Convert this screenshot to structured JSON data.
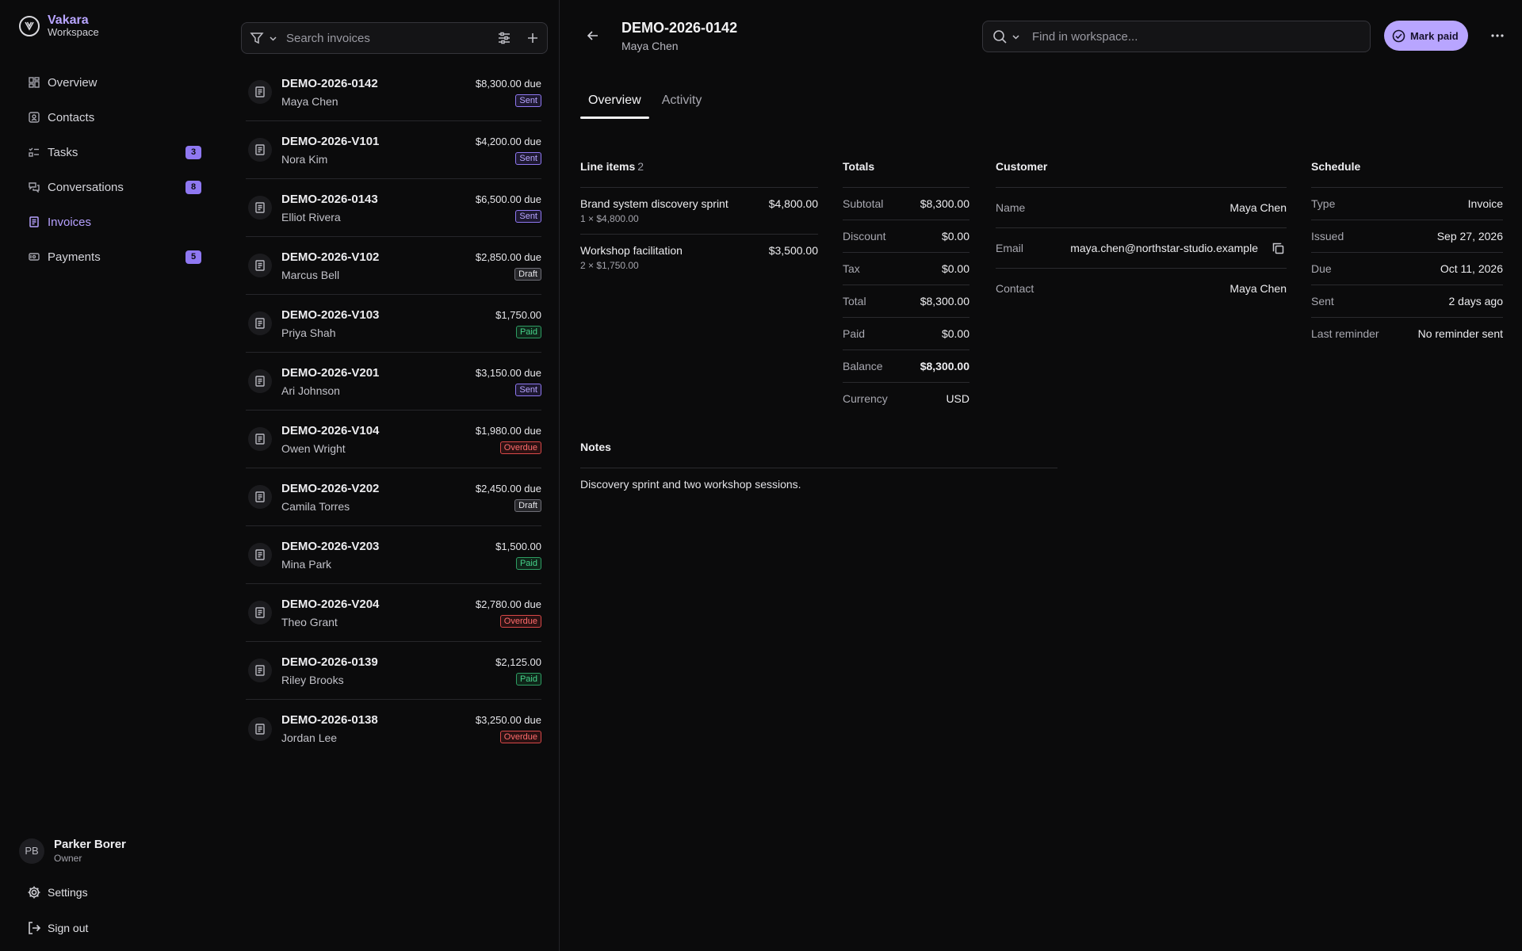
{
  "brand": {
    "name": "Vakara",
    "subtitle": "Workspace"
  },
  "nav": [
    {
      "label": "Overview",
      "icon": "dashboard-icon",
      "badge": null,
      "active": false
    },
    {
      "label": "Contacts",
      "icon": "contacts-icon",
      "badge": null,
      "active": false
    },
    {
      "label": "Tasks",
      "icon": "tasks-icon",
      "badge": "3",
      "active": false
    },
    {
      "label": "Conversations",
      "icon": "chat-icon",
      "badge": "8",
      "active": false
    },
    {
      "label": "Invoices",
      "icon": "invoice-icon",
      "badge": null,
      "active": true
    },
    {
      "label": "Payments",
      "icon": "payment-icon",
      "badge": "5",
      "active": false
    }
  ],
  "user": {
    "initials": "PB",
    "name": "Parker Borer",
    "role": "Owner"
  },
  "settings_label": "Settings",
  "signout_label": "Sign out",
  "list": {
    "search_placeholder": "Search invoices",
    "invoices": [
      {
        "number": "DEMO-2026-0142",
        "customer": "Maya Chen",
        "amount": "$8,300.00 due",
        "status": "Sent"
      },
      {
        "number": "DEMO-2026-V101",
        "customer": "Nora Kim",
        "amount": "$4,200.00 due",
        "status": "Sent"
      },
      {
        "number": "DEMO-2026-0143",
        "customer": "Elliot Rivera",
        "amount": "$6,500.00 due",
        "status": "Sent"
      },
      {
        "number": "DEMO-2026-V102",
        "customer": "Marcus Bell",
        "amount": "$2,850.00 due",
        "status": "Draft"
      },
      {
        "number": "DEMO-2026-V103",
        "customer": "Priya Shah",
        "amount": "$1,750.00",
        "status": "Paid"
      },
      {
        "number": "DEMO-2026-V201",
        "customer": "Ari Johnson",
        "amount": "$3,150.00 due",
        "status": "Sent"
      },
      {
        "number": "DEMO-2026-V104",
        "customer": "Owen Wright",
        "amount": "$1,980.00 due",
        "status": "Overdue"
      },
      {
        "number": "DEMO-2026-V202",
        "customer": "Camila Torres",
        "amount": "$2,450.00 due",
        "status": "Draft"
      },
      {
        "number": "DEMO-2026-V203",
        "customer": "Mina Park",
        "amount": "$1,500.00",
        "status": "Paid"
      },
      {
        "number": "DEMO-2026-V204",
        "customer": "Theo Grant",
        "amount": "$2,780.00 due",
        "status": "Overdue"
      },
      {
        "number": "DEMO-2026-0139",
        "customer": "Riley Brooks",
        "amount": "$2,125.00",
        "status": "Paid"
      },
      {
        "number": "DEMO-2026-0138",
        "customer": "Jordan Lee",
        "amount": "$3,250.00 due",
        "status": "Overdue"
      }
    ]
  },
  "detail": {
    "title": "DEMO-2026-0142",
    "subtitle": "Maya Chen",
    "search_placeholder": "Find in workspace...",
    "mark_paid_label": "Mark paid",
    "tabs": [
      {
        "label": "Overview",
        "active": true
      },
      {
        "label": "Activity",
        "active": false
      }
    ],
    "line_items": {
      "title": "Line items",
      "count": "2",
      "items": [
        {
          "name": "Brand system discovery sprint",
          "meta": "1 × $4,800.00",
          "amount": "$4,800.00"
        },
        {
          "name": "Workshop facilitation",
          "meta": "2 × $1,750.00",
          "amount": "$3,500.00"
        }
      ]
    },
    "totals": {
      "title": "Totals",
      "rows": [
        {
          "k": "Subtotal",
          "v": "$8,300.00"
        },
        {
          "k": "Discount",
          "v": "$0.00"
        },
        {
          "k": "Tax",
          "v": "$0.00"
        },
        {
          "k": "Total",
          "v": "$8,300.00"
        },
        {
          "k": "Paid",
          "v": "$0.00"
        },
        {
          "k": "Balance",
          "v": "$8,300.00",
          "strong": true
        },
        {
          "k": "Currency",
          "v": "USD"
        }
      ]
    },
    "customer": {
      "title": "Customer",
      "name_label": "Name",
      "name": "Maya Chen",
      "email_label": "Email",
      "email": "maya.chen@northstar-studio.example",
      "contact_label": "Contact",
      "contact": "Maya Chen"
    },
    "schedule": {
      "title": "Schedule",
      "rows": [
        {
          "k": "Type",
          "v": "Invoice"
        },
        {
          "k": "Issued",
          "v": "Sep 27, 2026"
        },
        {
          "k": "Due",
          "v": "Oct 11, 2026"
        },
        {
          "k": "Sent",
          "v": "2 days ago"
        },
        {
          "k": "Last reminder",
          "v": "No reminder sent"
        }
      ]
    },
    "notes": {
      "title": "Notes",
      "text": "Discovery sprint and two workshop sessions."
    }
  },
  "colors": {
    "accent": "#b8a5ff",
    "accent_badge": "#8f78f2",
    "status_sent": "#b8a5ff",
    "status_paid": "#46d28a",
    "status_overdue": "#ff6b6b",
    "status_draft": "#e4e4e8",
    "background": "#0b0b0c"
  }
}
